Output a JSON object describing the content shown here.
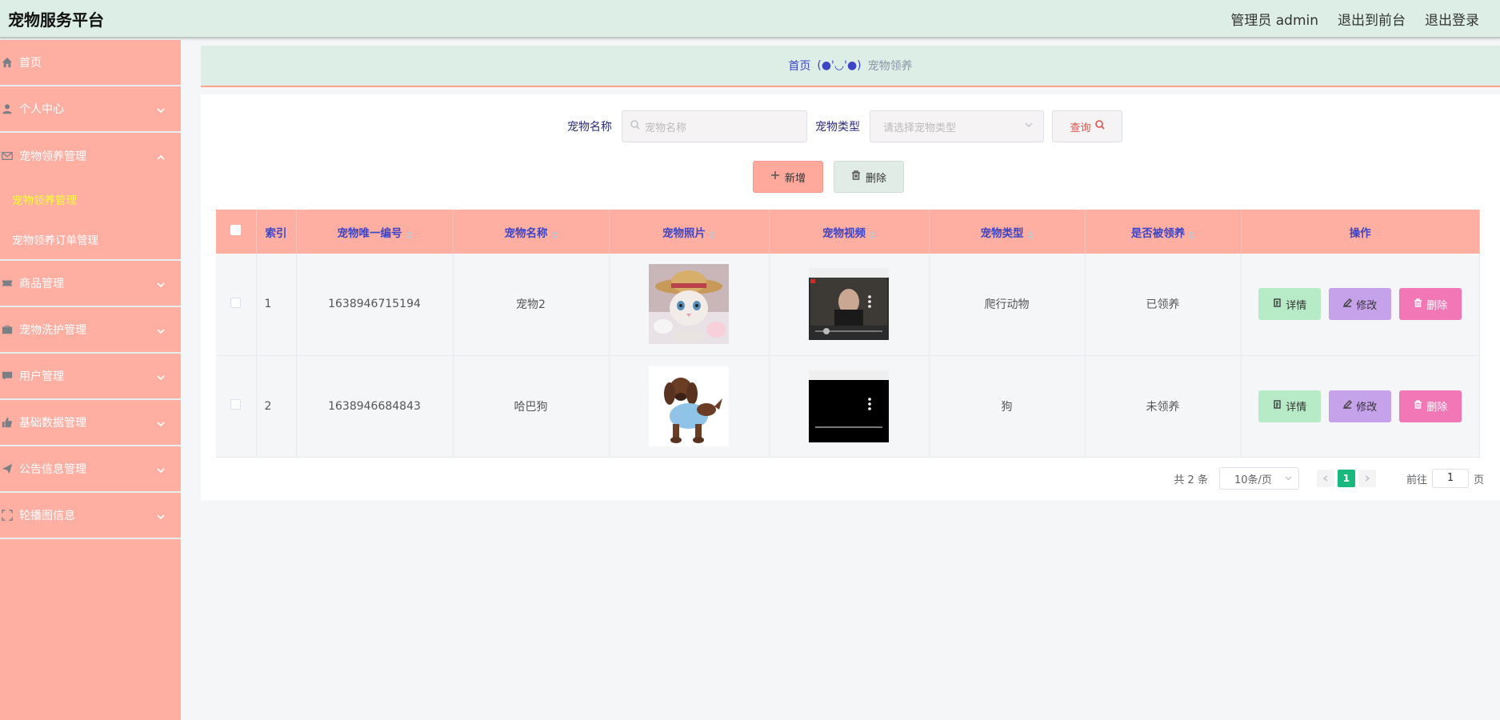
{
  "app": {
    "title": "宠物服务平台",
    "admin_label": "管理员 admin",
    "back_to_front": "退出到前台",
    "logout": "退出登录"
  },
  "sidebar": {
    "items": [
      {
        "label": "首页",
        "icon": "home-icon"
      },
      {
        "label": "个人中心",
        "icon": "user-icon"
      },
      {
        "label": "宠物领养管理",
        "icon": "mail-icon"
      },
      {
        "label": "商品管理",
        "icon": "ticket-icon"
      },
      {
        "label": "宠物洗护管理",
        "icon": "briefcase-icon"
      },
      {
        "label": "用户管理",
        "icon": "chat-icon"
      },
      {
        "label": "基础数据管理",
        "icon": "thumb-icon"
      },
      {
        "label": "公告信息管理",
        "icon": "send-icon"
      },
      {
        "label": "轮播图信息",
        "icon": "fullscreen-icon"
      }
    ],
    "submenu": [
      {
        "label": "宠物领养管理",
        "active": true
      },
      {
        "label": "宠物领养订单管理",
        "active": false
      }
    ]
  },
  "breadcrumb": {
    "home": "首页",
    "separator": "(●'◡'●)",
    "current": "宠物领养"
  },
  "search": {
    "name_label": "宠物名称",
    "name_placeholder": "宠物名称",
    "type_label": "宠物类型",
    "type_placeholder": "请选择宠物类型",
    "query_label": "查询"
  },
  "actions": {
    "add_label": "新增",
    "delete_label": "删除"
  },
  "table": {
    "headers": [
      "索引",
      "宠物唯一编号",
      "宠物名称",
      "宠物照片",
      "宠物视频",
      "宠物类型",
      "是否被领养",
      "操作"
    ],
    "rows": [
      {
        "index": "1",
        "code": "1638946715194",
        "name": "宠物2",
        "photo": "cat-photo",
        "video": "video-thumbnail",
        "type": "爬行动物",
        "adopted": "已领养"
      },
      {
        "index": "2",
        "code": "1638946684843",
        "name": "哈巴狗",
        "photo": "dog-photo",
        "video": "video-thumbnail",
        "type": "狗",
        "adopted": "未领养"
      }
    ],
    "op_detail": "详情",
    "op_edit": "修改",
    "op_delete": "删除"
  },
  "pagination": {
    "total": "共 2 条",
    "page_size": "10条/页",
    "current_page": "1",
    "goto_label": "前往",
    "goto_value": "1",
    "page_suffix": "页"
  },
  "colors": {
    "sidebar": "#ffaea2",
    "header": "#ddeee6",
    "accent_blue": "#3d45c5",
    "pager_active": "#18b87e"
  }
}
